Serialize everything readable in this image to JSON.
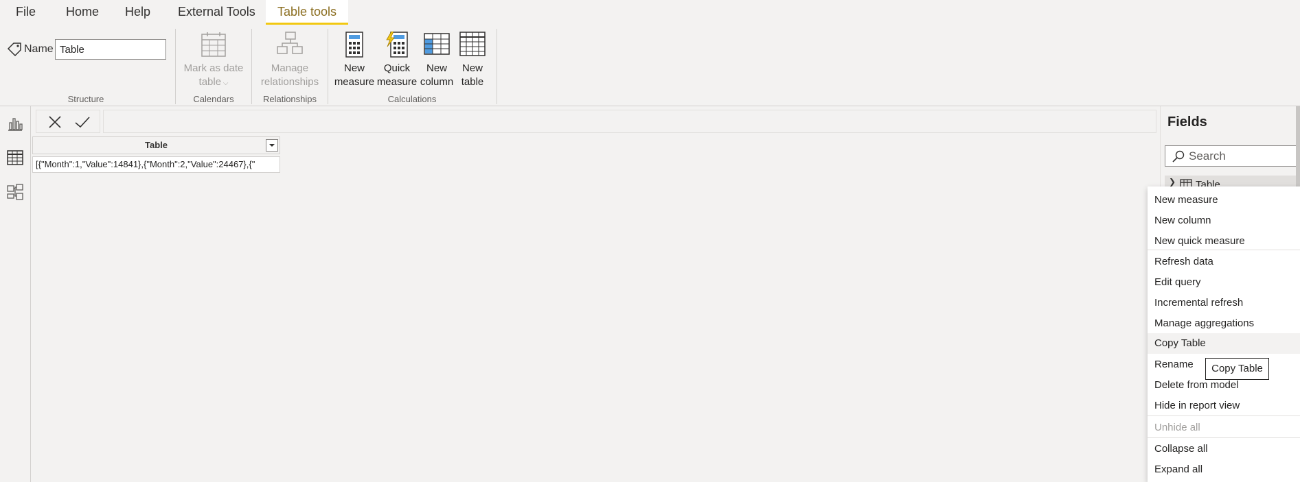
{
  "menu": {
    "tabs": [
      {
        "label": "File"
      },
      {
        "label": "Home"
      },
      {
        "label": "Help"
      },
      {
        "label": "External Tools"
      },
      {
        "label": "Table tools"
      }
    ]
  },
  "ribbon": {
    "structure": {
      "name_label": "Name",
      "name_value": "Table",
      "group_label": "Structure"
    },
    "calendars": {
      "mark_date_line1": "Mark as date",
      "mark_date_line2": "table",
      "group_label": "Calendars"
    },
    "relationships": {
      "manage_line1": "Manage",
      "manage_line2": "relationships",
      "group_label": "Relationships"
    },
    "calculations": {
      "new_measure_line1": "New",
      "new_measure_line2": "measure",
      "quick_measure_line1": "Quick",
      "quick_measure_line2": "measure",
      "new_column_line1": "New",
      "new_column_line2": "column",
      "new_table_line1": "New",
      "new_table_line2": "table",
      "group_label": "Calculations"
    }
  },
  "grid": {
    "column_header": "Table",
    "cell_value": "[{\"Month\":1,\"Value\":14841},{\"Month\":2,\"Value\":24467},{\""
  },
  "fields": {
    "title": "Fields",
    "search_placeholder": "Search",
    "table_name": "Table"
  },
  "context_menu": {
    "items": [
      {
        "label": "New measure"
      },
      {
        "label": "New column"
      },
      {
        "label": "New quick measure"
      },
      {
        "label": "Refresh data"
      },
      {
        "label": "Edit query"
      },
      {
        "label": "Incremental refresh"
      },
      {
        "label": "Manage aggregations"
      },
      {
        "label": "Copy Table"
      },
      {
        "label": "Rename"
      },
      {
        "label": "Delete from model"
      },
      {
        "label": "Hide in report view"
      },
      {
        "label": "Unhide all"
      },
      {
        "label": "Collapse all"
      },
      {
        "label": "Expand all"
      }
    ],
    "tooltip": "Copy Table"
  },
  "colors": {
    "accent": "#f2c811",
    "active_tab_text": "#8a6d1f",
    "background": "#f3f2f1"
  }
}
